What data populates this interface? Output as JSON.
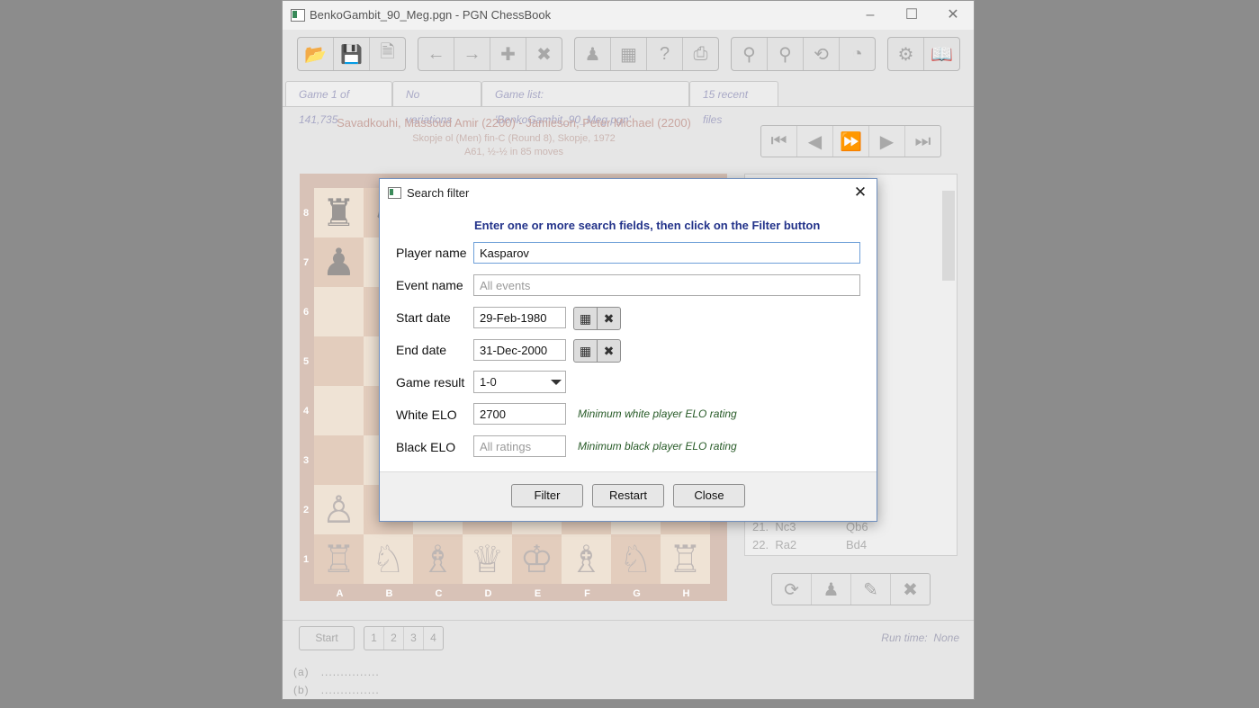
{
  "window": {
    "title": "BenkoGambit_90_Meg.pgn - PGN ChessBook"
  },
  "tabs": [
    "Game 1 of 141,735",
    "No variations",
    "Game list:  'BenkoGambit_90_Meg.pgn'",
    "15 recent files"
  ],
  "game": {
    "players": "Savadkouhi, Massoud Amir (2200) - Jamieson, Peter Michael (2200)",
    "event": "Skopje ol (Men) fin-C (Round 8),  Skopje,  1972",
    "info": "A61,  ½-½  in 85 moves"
  },
  "board": {
    "ranks": [
      "8",
      "7",
      "6",
      "5",
      "4",
      "3",
      "2",
      "1"
    ],
    "files": [
      "A",
      "B",
      "C",
      "D",
      "E",
      "F",
      "G",
      "H"
    ]
  },
  "moves": [
    {
      "num": "21.",
      "white": "Nc3",
      "black": "Qb6"
    },
    {
      "num": "22.",
      "white": "Ra2",
      "black": "Bd4"
    }
  ],
  "bottom": {
    "start_label": "Start",
    "pages": [
      "1",
      "2",
      "3",
      "4"
    ],
    "runtime_label": "Run time:",
    "runtime_value": "None",
    "line_a": "(a)",
    "line_b": "(b)",
    "dots": "..............."
  },
  "dialog": {
    "title": "Search filter",
    "instructions": "Enter one or more search fields, then click on the Filter button",
    "fields": {
      "player_label": "Player name",
      "player_value": "Kasparov",
      "event_label": "Event name",
      "event_placeholder": "All events",
      "start_label": "Start date",
      "start_value": "29-Feb-1980",
      "end_label": "End date",
      "end_value": "31-Dec-2000",
      "result_label": "Game result",
      "result_value": "1-0",
      "white_label": "White ELO",
      "white_value": "2700",
      "white_hint": "Minimum white player ELO rating",
      "black_label": "Black ELO",
      "black_placeholder": "All ratings",
      "black_hint": "Minimum black player ELO rating"
    },
    "buttons": {
      "filter": "Filter",
      "restart": "Restart",
      "close": "Close"
    }
  }
}
